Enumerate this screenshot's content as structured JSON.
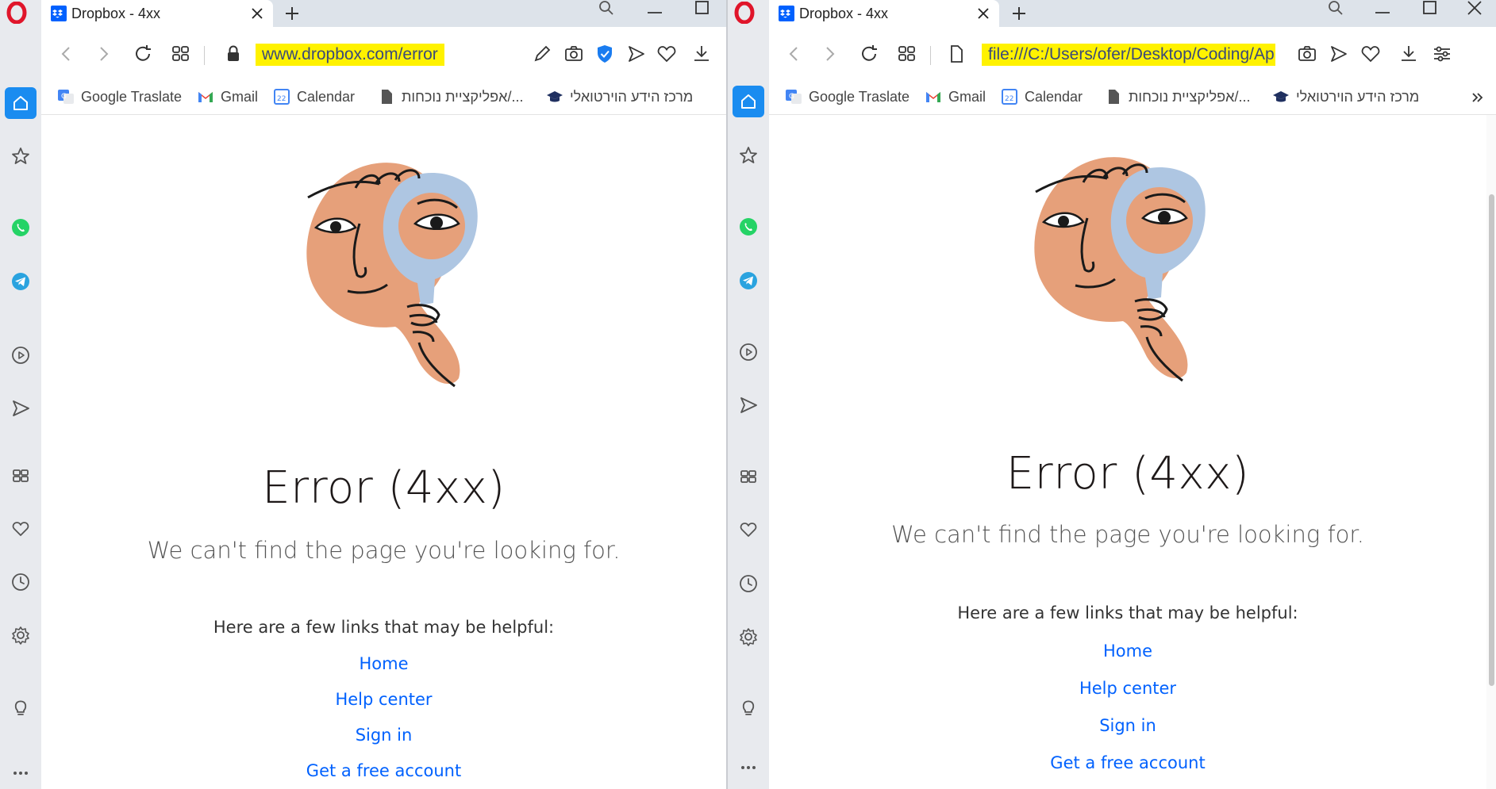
{
  "left": {
    "tab": {
      "title": "Dropbox - 4xx"
    },
    "address": {
      "url": "www.dropbox.com/error"
    },
    "bookmarks": [
      {
        "label": "Google Traslate",
        "icon": "google-translate-icon"
      },
      {
        "label": "Gmail",
        "icon": "gmail-icon"
      },
      {
        "label": "Calendar",
        "icon": "calendar-icon"
      },
      {
        "label": "אפליקציית נוכחות/...",
        "icon": "document-icon"
      },
      {
        "label": "מרכז הידע הוירטואלי",
        "icon": "graduation-cap-icon"
      }
    ],
    "content": {
      "title": "Error (4xx)",
      "subtitle": "We can't find the page you're looking for.",
      "help_text": "Here are a few links that may be helpful:",
      "links": [
        "Home",
        "Help center",
        "Sign in",
        "Get a free account"
      ]
    }
  },
  "right": {
    "tab": {
      "title": "Dropbox - 4xx"
    },
    "address": {
      "url": "file:///C:/Users/ofer/Desktop/Coding/App"
    },
    "bookmarks": [
      {
        "label": "Google Traslate",
        "icon": "google-translate-icon"
      },
      {
        "label": "Gmail",
        "icon": "gmail-icon"
      },
      {
        "label": "Calendar",
        "icon": "calendar-icon"
      },
      {
        "label": "אפליקציית נוכחות/...",
        "icon": "document-icon"
      },
      {
        "label": "מרכז הידע הוירטואלי",
        "icon": "graduation-cap-icon"
      }
    ],
    "content": {
      "title": "Error (4xx)",
      "subtitle": "We can't find the page you're looking for.",
      "help_text": "Here are a few links that may be helpful:",
      "links": [
        "Home",
        "Help center",
        "Sign in",
        "Get a free account"
      ]
    }
  },
  "colors": {
    "highlight": "#fff200",
    "link": "#0061fe",
    "opera_red": "#e0152a",
    "sidebar_active": "#1a8cf0",
    "illustration_skin": "#e6a07a",
    "illustration_mirror": "#aec6e2"
  }
}
